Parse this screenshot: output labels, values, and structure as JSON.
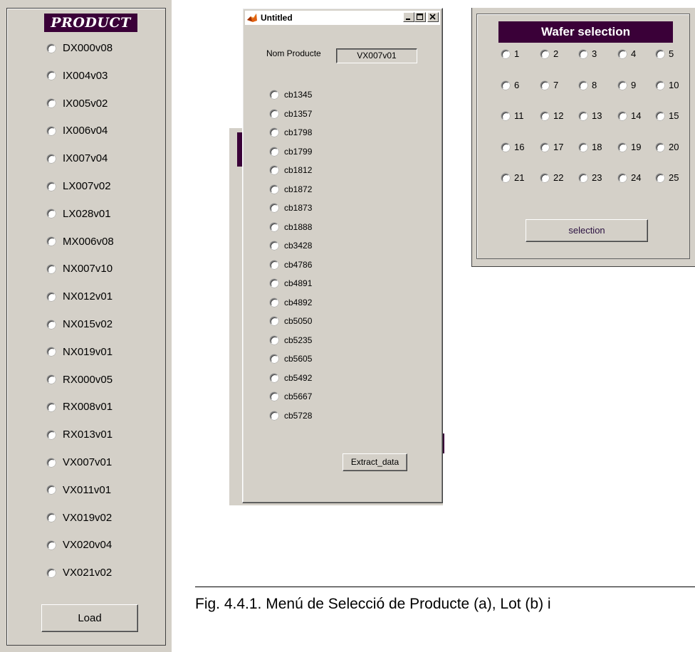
{
  "product_panel": {
    "title": "PRODUCT",
    "products": [
      "DX000v08",
      "IX004v03",
      "IX005v02",
      "IX006v04",
      "IX007v04",
      "LX007v02",
      "LX028v01",
      "MX006v08",
      "NX007v10",
      "NX012v01",
      "NX015v02",
      "NX019v01",
      "RX000v05",
      "RX008v01",
      "RX013v01",
      "VX007v01",
      "VX011v01",
      "VX019v02",
      "VX020v04",
      "VX021v02"
    ],
    "load_label": "Load"
  },
  "lot_window": {
    "title": "Untitled",
    "nom_label": "Nom Producte",
    "nom_value": "VX007v01",
    "lots": [
      "cb1345",
      "cb1357",
      "cb1798",
      "cb1799",
      "cb1812",
      "cb1872",
      "cb1873",
      "cb1888",
      "cb3428",
      "cb4786",
      "cb4891",
      "cb4892",
      "cb5050",
      "cb5235",
      "cb5605",
      "cb5492",
      "cb5667",
      "cb5728"
    ],
    "extract_label": "Extract_data"
  },
  "wafer_panel": {
    "title": "Wafer selection",
    "wafers": [
      "1",
      "2",
      "3",
      "4",
      "5",
      "6",
      "7",
      "8",
      "9",
      "10",
      "11",
      "12",
      "13",
      "14",
      "15",
      "16",
      "17",
      "18",
      "19",
      "20",
      "21",
      "22",
      "23",
      "24",
      "25"
    ],
    "selection_label": "selection"
  },
  "caption": "Fig.  4.4.1.  Menú de Selecció de Producte (a), Lot (b) i",
  "colors": {
    "title_bg": "#3a0038",
    "panel_bg": "#d4d0c8"
  },
  "icons": {
    "app": "matlab-icon",
    "minimize": "minimize-icon",
    "maximize": "maximize-icon",
    "close": "close-icon"
  }
}
